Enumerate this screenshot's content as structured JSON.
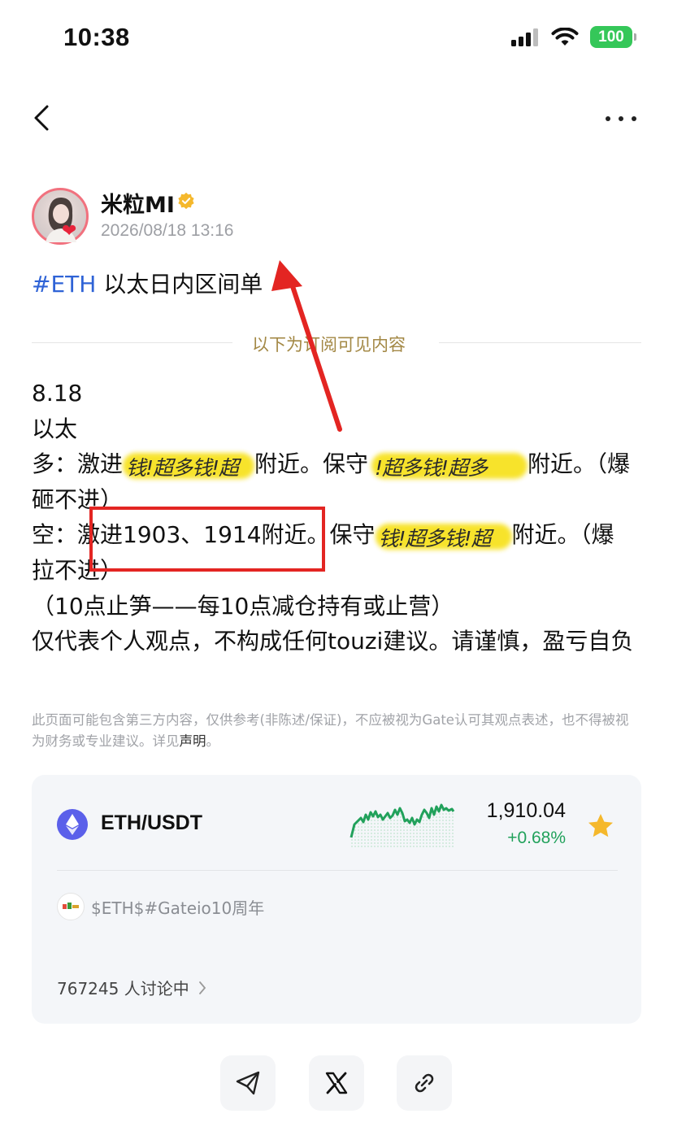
{
  "status_bar": {
    "time": "10:38",
    "battery": "100"
  },
  "nav": {
    "back_icon": "chevron-left-icon",
    "more_icon": "more-horizontal-icon"
  },
  "author": {
    "name": "米粒MI",
    "time": "2026/08/18 13:16",
    "verified_icon": "verified-badge-icon"
  },
  "post": {
    "hashtag": "#ETH",
    "title": " 以太日内区间单",
    "divider_text": "以下为订阅可见内容",
    "line_date": "8.18",
    "line_asset": "以太",
    "long_prefix": "多：激进",
    "long_mid": "附近。保守",
    "long_end": "附近。（爆",
    "long_cont": "砸不进）",
    "short_prefix": "空：激进1903、1914附近。保守",
    "short_end": "附近。（爆",
    "short_cont": "拉不进）",
    "stop_line": "（10点止笋——每10点减仓持有或止营）",
    "opinion": "仅代表个人观点，不构成任何touzi建议。请谨慎，盈亏自负",
    "sticker_1": "钱!超多钱!超",
    "sticker_2": "!超多钱!超多",
    "sticker_3": "钱!超多钱!超",
    "sticker_color": "#f7e11a",
    "highlight_box_color": "#e32522"
  },
  "disclaimer": {
    "text": "此页面可能包含第三方内容，仅供参考(非陈述/保证)，不应被视为Gate认可其观点表述，也不得被视为财务或专业建议。详见",
    "link": "声明",
    "end": "。"
  },
  "market_card": {
    "pair": "ETH/USDT",
    "price": "1,910.04",
    "change": "+0.68%",
    "change_color": "#21a15b",
    "topic": "$ETH$#Gateio10周年",
    "discussing": "767245 人讨论中"
  },
  "share": {
    "telegram_icon": "telegram-icon",
    "x_icon": "x-icon",
    "link_icon": "link-icon"
  }
}
